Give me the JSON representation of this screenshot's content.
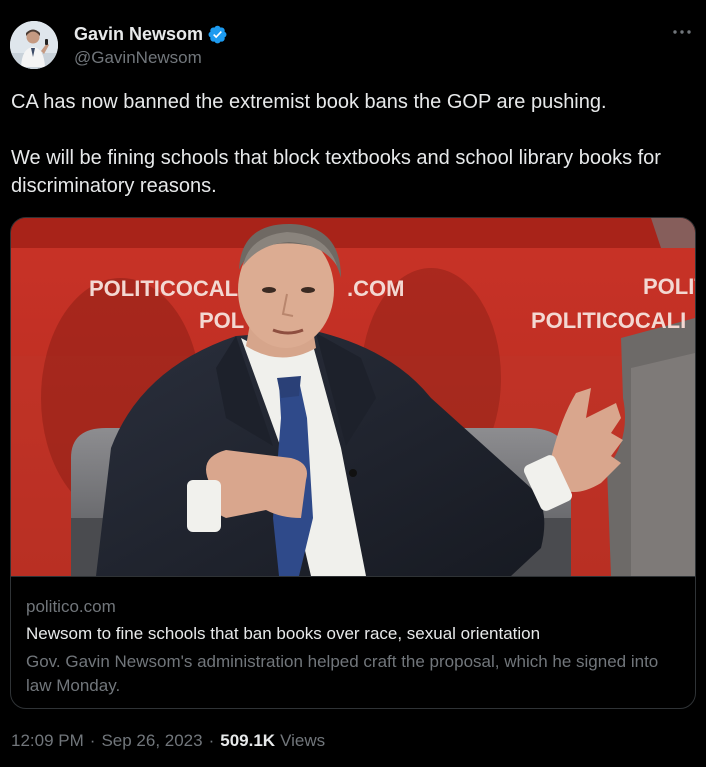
{
  "author": {
    "display_name": "Gavin Newsom",
    "handle": "@GavinNewsom",
    "verified": true,
    "avatar_icon": "person-avatar"
  },
  "tweet": {
    "paragraphs": [
      "CA has now banned the extremist book bans the GOP are pushing.",
      "We will be fining schools that block textbooks and school library books for discriminatory reasons."
    ]
  },
  "card": {
    "image": {
      "backdrop_text_left_top": "POLITICOCAL",
      "backdrop_text_left_top_end": ".COM",
      "backdrop_text_left_bottom": "POL",
      "backdrop_text_right_top": "POLIT",
      "backdrop_text_right_bottom": "POLITICOCALI"
    },
    "domain": "politico.com",
    "title": "Newsom to fine schools that ban books over race, sexual orientation",
    "description": "Gov. Gavin Newsom's administration helped craft the proposal, which he signed into law Monday."
  },
  "footer": {
    "time": "12:09 PM",
    "date": "Sep 26, 2023",
    "views_count": "509.1K",
    "views_label": "Views"
  },
  "colors": {
    "background": "#000000",
    "text_primary": "#e7e9ea",
    "text_secondary": "#71767b",
    "verified_blue": "#1d9bf0",
    "border": "#2f3336",
    "backdrop_red": "#d23a2b"
  }
}
